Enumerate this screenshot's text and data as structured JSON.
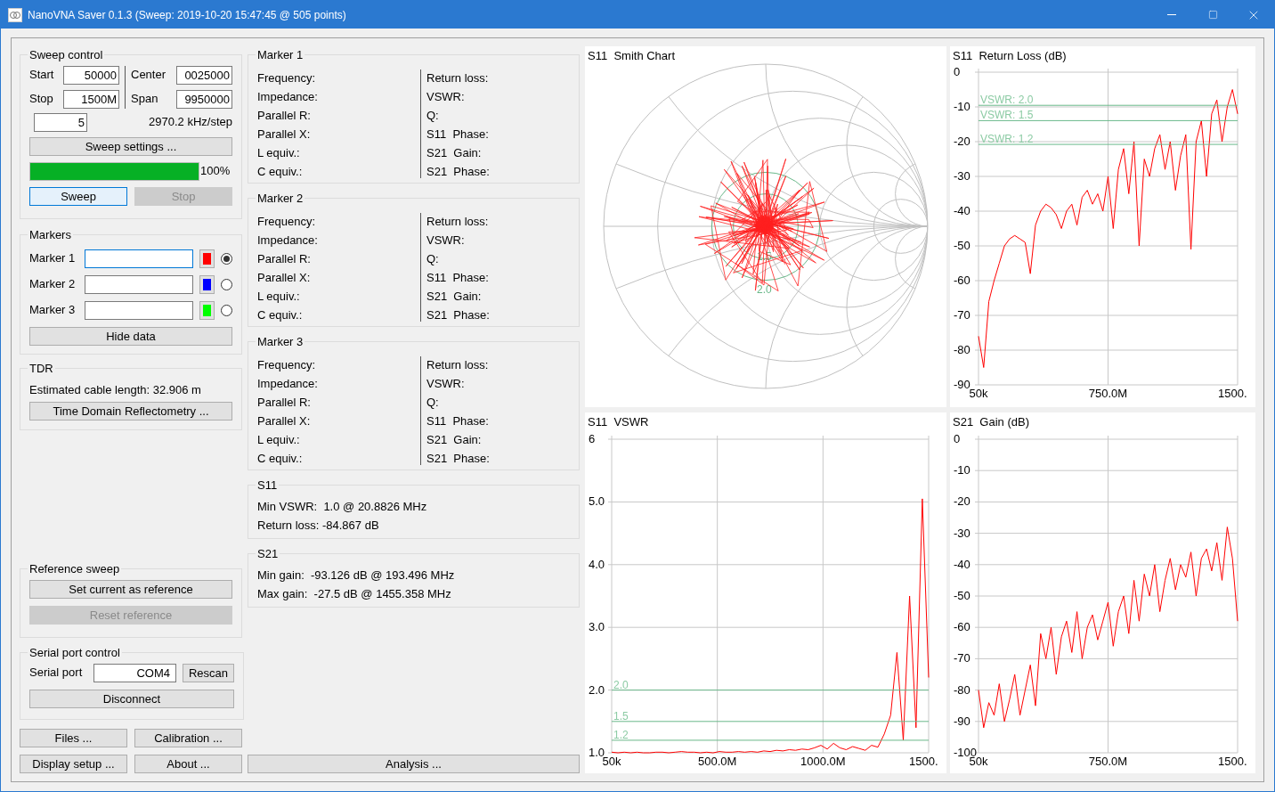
{
  "window": {
    "title": "NanoVNA Saver 0.1.3 (Sweep: 2019-10-20 15:47:45 @ 505 points)"
  },
  "sweep_control": {
    "title": "Sweep control",
    "fields": [
      {
        "label": "Start",
        "value": "50000"
      },
      {
        "label": "Stop",
        "value": "1500M"
      },
      {
        "label": "Center",
        "value": "0025000"
      },
      {
        "label": "Span",
        "value": "9950000"
      }
    ],
    "segments": "5",
    "step": "2970.2 kHz/step",
    "settings_button": "Sweep settings ...",
    "progress": {
      "level": 1.0,
      "reading": "100%"
    },
    "buttons": [
      {
        "label": "Sweep",
        "disabled": false,
        "focused": true
      },
      {
        "label": "Stop",
        "disabled": true,
        "focused": false
      }
    ]
  },
  "markers": {
    "title": "Markers",
    "items": [
      {
        "label": "Marker 1",
        "color": "#ff0000",
        "selected": true,
        "focused": true
      },
      {
        "label": "Marker 2",
        "color": "#0000ff",
        "selected": false,
        "focused": false
      },
      {
        "label": "Marker 3",
        "color": "#00ff00",
        "selected": false,
        "focused": false
      }
    ],
    "hide_button": "Hide data"
  },
  "tdr": {
    "title": "TDR",
    "text": "Estimated cable length: 32.906 m",
    "button": "Time Domain Reflectometry ..."
  },
  "reference_sweep": {
    "title": "Reference sweep",
    "buttons": [
      {
        "label": "Set current as reference",
        "disabled": false
      },
      {
        "label": "Reset reference",
        "disabled": true
      }
    ]
  },
  "serial_port": {
    "title": "Serial port control",
    "label": "Serial port",
    "value": "COM4",
    "rescan_button": "Rescan",
    "disconnect_button": "Disconnect"
  },
  "bottom_buttons": [
    "Files ...",
    "Calibration ...",
    "Display setup ...",
    "About ..."
  ],
  "marker_panels": [
    {
      "title": "Marker 1",
      "left": [
        "Frequency:",
        "Impedance:",
        "Parallel R:",
        "Parallel X:",
        "L equiv.:",
        "C equiv.:"
      ],
      "right": [
        "Return loss:",
        "VSWR:",
        "Q:",
        "S11  Phase:",
        "S21  Gain:",
        "S21  Phase:"
      ]
    },
    {
      "title": "Marker 2",
      "left": [
        "Frequency:",
        "Impedance:",
        "Parallel R:",
        "Parallel X:",
        "L equiv.:",
        "C equiv.:"
      ],
      "right": [
        "Return loss:",
        "VSWR:",
        "Q:",
        "S11  Phase:",
        "S21  Gain:",
        "S21  Phase:"
      ]
    },
    {
      "title": "Marker 3",
      "left": [
        "Frequency:",
        "Impedance:",
        "Parallel R:",
        "Parallel X:",
        "L equiv.:",
        "C equiv.:"
      ],
      "right": [
        "Return loss:",
        "VSWR:",
        "Q:",
        "S11  Phase:",
        "S21  Gain:",
        "S21  Phase:"
      ]
    }
  ],
  "summaries": [
    {
      "title": "S11",
      "lines": [
        "Min VSWR:  1.0 @ 20.8826 MHz",
        "Return loss: -84.867 dB"
      ]
    },
    {
      "title": "S21",
      "lines": [
        "Min gain:  -93.126 dB @ 193.496 MHz",
        "Max gain:  -27.5 dB @ 1455.358 MHz"
      ]
    }
  ],
  "analysis_button": "Analysis ...",
  "charts": [
    {
      "title": "S11  Smith Chart",
      "kind": "smith",
      "ref_labels": [
        "1.5",
        "2.0"
      ]
    },
    {
      "title": "S11  Return Loss (dB)",
      "kind": "return_loss",
      "x_end_label": "1500.",
      "threshold_labels": [
        "VSWR: 2.0",
        "VSWR: 1.5",
        "VSWR: 1.2"
      ],
      "chart_data": {
        "type": "line",
        "grid": true,
        "xlim": [
          50000,
          1500000000
        ],
        "ylim": [
          -90,
          0
        ],
        "x": [
          50000,
          30000000,
          60000000,
          90000000,
          120000000,
          150000000,
          180000000,
          210000000,
          240000000,
          270000000,
          300000000,
          330000000,
          360000000,
          390000000,
          420000000,
          450000000,
          480000000,
          510000000,
          540000000,
          570000000,
          600000000,
          630000000,
          660000000,
          690000000,
          720000000,
          750000000,
          780000000,
          810000000,
          840000000,
          870000000,
          900000000,
          930000000,
          960000000,
          990000000,
          1020000000,
          1050000000,
          1080000000,
          1110000000,
          1140000000,
          1170000000,
          1200000000,
          1230000000,
          1260000000,
          1290000000,
          1320000000,
          1350000000,
          1380000000,
          1410000000,
          1440000000,
          1470000000,
          1500000000
        ],
        "series": [
          {
            "color": "#ff0000",
            "values": [
              -76,
              -85,
              -66,
              -60,
              -55,
              -50,
              -48,
              -47,
              -48,
              -49,
              -58,
              -44,
              -40,
              -38,
              -39,
              -41,
              -45,
              -40,
              -38,
              -44,
              -36,
              -34,
              -38,
              -35,
              -40,
              -30,
              -45,
              -28,
              -22,
              -35,
              -20,
              -50,
              -25,
              -30,
              -22,
              -18,
              -28,
              -20,
              -34,
              -24,
              -18,
              -51,
              -20,
              -14,
              -30,
              -12,
              -8,
              -20,
              -10,
              -5,
              -12
            ]
          }
        ],
        "xticks": [
          {
            "value": 50000,
            "label": "50k"
          },
          {
            "value": 750000000,
            "label": "750.0M"
          }
        ],
        "yticks": [
          {
            "value": 0,
            "label": "0"
          },
          {
            "value": -10,
            "label": "-10"
          },
          {
            "value": -20,
            "label": "-20"
          },
          {
            "value": -30,
            "label": "-30"
          },
          {
            "value": -40,
            "label": "-40"
          },
          {
            "value": -50,
            "label": "-50"
          },
          {
            "value": -60,
            "label": "-60"
          },
          {
            "value": -70,
            "label": "-70"
          },
          {
            "value": -80,
            "label": "-80"
          },
          {
            "value": -90,
            "label": "-90"
          }
        ]
      }
    },
    {
      "title": "S11  VSWR",
      "kind": "vswr",
      "x_end_label": "1500.",
      "threshold_labels": [
        "2.0",
        "1.5",
        "1.2"
      ],
      "chart_data": {
        "type": "line",
        "grid": true,
        "xlim": [
          50000,
          1500000000
        ],
        "ylim": [
          1,
          6
        ],
        "x": [
          50000,
          30000000,
          60000000,
          90000000,
          120000000,
          150000000,
          180000000,
          210000000,
          240000000,
          270000000,
          300000000,
          330000000,
          360000000,
          390000000,
          420000000,
          450000000,
          480000000,
          510000000,
          540000000,
          570000000,
          600000000,
          630000000,
          660000000,
          690000000,
          720000000,
          750000000,
          780000000,
          810000000,
          840000000,
          870000000,
          900000000,
          930000000,
          960000000,
          990000000,
          1020000000,
          1050000000,
          1080000000,
          1110000000,
          1140000000,
          1170000000,
          1200000000,
          1230000000,
          1260000000,
          1290000000,
          1320000000,
          1350000000,
          1380000000,
          1410000000,
          1440000000,
          1470000000,
          1500000000
        ],
        "series": [
          {
            "color": "#ff0000",
            "values": [
              1.01,
              1.0,
              1.01,
              1.0,
              1.01,
              1.0,
              1.0,
              1.01,
              1.01,
              1.0,
              1.01,
              1.02,
              1.01,
              1.01,
              1.0,
              1.01,
              1.0,
              1.02,
              1.01,
              1.01,
              1.02,
              1.01,
              1.02,
              1.01,
              1.03,
              1.02,
              1.04,
              1.03,
              1.05,
              1.04,
              1.06,
              1.05,
              1.08,
              1.12,
              1.06,
              1.15,
              1.08,
              1.05,
              1.1,
              1.07,
              1.04,
              1.12,
              1.09,
              1.3,
              1.6,
              2.6,
              1.2,
              3.5,
              1.4,
              5.05,
              2.2
            ]
          }
        ],
        "xticks": [
          {
            "value": 50000,
            "label": "50k"
          },
          {
            "value": 500000000,
            "label": "500.0M"
          },
          {
            "value": 1000000000,
            "label": "1000.0M"
          }
        ],
        "yticks": [
          {
            "value": 6,
            "label": "6"
          },
          {
            "value": 5,
            "label": "5.0"
          },
          {
            "value": 4,
            "label": "4.0"
          },
          {
            "value": 3,
            "label": "3.0"
          },
          {
            "value": 2,
            "label": "2.0"
          },
          {
            "value": 1,
            "label": "1.0"
          }
        ]
      }
    },
    {
      "title": "S21  Gain (dB)",
      "kind": "gain",
      "x_end_label": "1500.",
      "chart_data": {
        "type": "line",
        "grid": true,
        "xlim": [
          50000,
          1500000000
        ],
        "ylim": [
          -100,
          0
        ],
        "x": [
          50000,
          30000000,
          60000000,
          90000000,
          120000000,
          150000000,
          180000000,
          210000000,
          240000000,
          270000000,
          300000000,
          330000000,
          360000000,
          390000000,
          420000000,
          450000000,
          480000000,
          510000000,
          540000000,
          570000000,
          600000000,
          630000000,
          660000000,
          690000000,
          720000000,
          750000000,
          780000000,
          810000000,
          840000000,
          870000000,
          900000000,
          930000000,
          960000000,
          990000000,
          1020000000,
          1050000000,
          1080000000,
          1110000000,
          1140000000,
          1170000000,
          1200000000,
          1230000000,
          1260000000,
          1290000000,
          1320000000,
          1350000000,
          1380000000,
          1410000000,
          1440000000,
          1470000000,
          1500000000
        ],
        "series": [
          {
            "color": "#ff0000",
            "values": [
              -80,
              -92,
              -84,
              -88,
              -78,
              -90,
              -83,
              -75,
              -88,
              -80,
              -72,
              -85,
              -62,
              -70,
              -60,
              -75,
              -63,
              -58,
              -68,
              -55,
              -70,
              -60,
              -56,
              -64,
              -58,
              -52,
              -66,
              -55,
              -50,
              -62,
              -45,
              -58,
              -43,
              -50,
              -40,
              -55,
              -45,
              -38,
              -48,
              -40,
              -44,
              -36,
              -50,
              -38,
              -35,
              -42,
              -33,
              -45,
              -28,
              -38,
              -58
            ]
          }
        ],
        "xticks": [
          {
            "value": 50000,
            "label": "50k"
          },
          {
            "value": 750000000,
            "label": "750.0M"
          }
        ],
        "yticks": [
          {
            "value": 0,
            "label": "0"
          },
          {
            "value": -10,
            "label": "-10"
          },
          {
            "value": -20,
            "label": "-20"
          },
          {
            "value": -30,
            "label": "-30"
          },
          {
            "value": -40,
            "label": "-40"
          },
          {
            "value": -50,
            "label": "-50"
          },
          {
            "value": -60,
            "label": "-60"
          },
          {
            "value": -70,
            "label": "-70"
          },
          {
            "value": -80,
            "label": "-80"
          },
          {
            "value": -90,
            "label": "-90"
          },
          {
            "value": -100,
            "label": "-100"
          }
        ]
      }
    }
  ]
}
